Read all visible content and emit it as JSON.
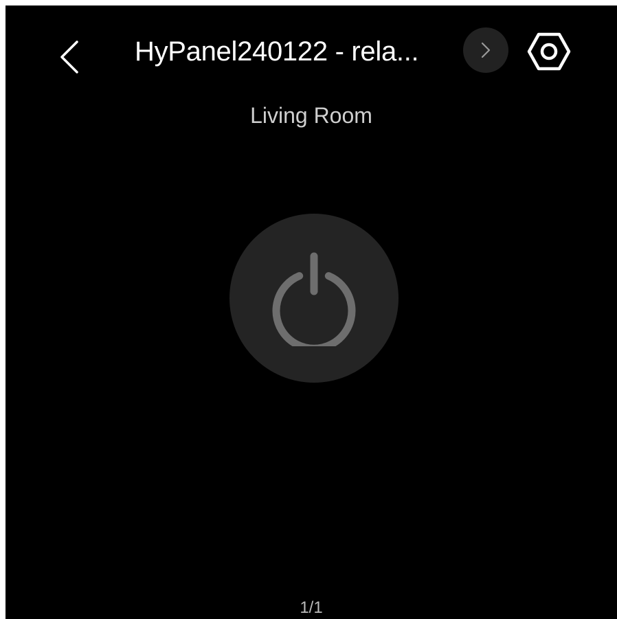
{
  "header": {
    "title": "HyPanel240122 - rela...",
    "back_icon": "chevron-left-icon",
    "next_icon": "chevron-right-icon",
    "settings_icon": "hex-settings-icon"
  },
  "room": {
    "name": "Living Room"
  },
  "device": {
    "power_icon": "power-icon",
    "power_state": "off"
  },
  "pagination": {
    "text": "1/1"
  },
  "colors": {
    "background": "#000000",
    "button_bg": "#242424",
    "power_icon": "#6e6e6e",
    "text_primary": "#ffffff",
    "text_secondary": "#cfcfcf"
  }
}
